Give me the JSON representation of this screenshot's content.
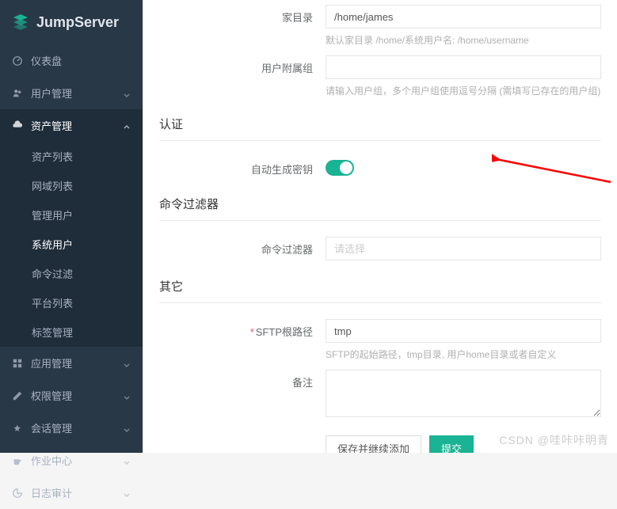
{
  "brand": "JumpServer",
  "sidebar": {
    "items": [
      {
        "label": "仪表盘",
        "expandable": false
      },
      {
        "label": "用户管理",
        "expandable": true
      },
      {
        "label": "资产管理",
        "expandable": true,
        "active": true
      },
      {
        "label": "应用管理",
        "expandable": true
      },
      {
        "label": "权限管理",
        "expandable": true
      },
      {
        "label": "会话管理",
        "expandable": true
      },
      {
        "label": "作业中心",
        "expandable": true
      },
      {
        "label": "日志审计",
        "expandable": true
      }
    ],
    "asset_sub": [
      {
        "label": "资产列表"
      },
      {
        "label": "网域列表"
      },
      {
        "label": "管理用户"
      },
      {
        "label": "系统用户",
        "active": true
      },
      {
        "label": "命令过滤"
      },
      {
        "label": "平台列表"
      },
      {
        "label": "标签管理"
      }
    ]
  },
  "form": {
    "home_dir": {
      "label": "家目录",
      "value": "/home/james",
      "help": "默认家目录 /home/系统用户名: /home/username"
    },
    "user_groups": {
      "label": "用户附属组",
      "placeholder": "",
      "help": "请输入用户组，多个用户组使用逗号分隔 (需填写已存在的用户组)"
    },
    "auth_section": "认证",
    "auto_key": {
      "label": "自动生成密钥",
      "on": true
    },
    "cmd_filter_section": "命令过滤器",
    "cmd_filter": {
      "label": "命令过滤器",
      "placeholder": "请选择"
    },
    "other_section": "其它",
    "sftp_root": {
      "label": "SFTP根路径",
      "value": "tmp",
      "help": "SFTP的起始路径，tmp目录, 用户home目录或者自定义"
    },
    "remark": {
      "label": "备注"
    },
    "buttons": {
      "save_continue": "保存并继续添加",
      "submit": "提交"
    }
  },
  "watermark": "CSDN @哇咔咔明青"
}
